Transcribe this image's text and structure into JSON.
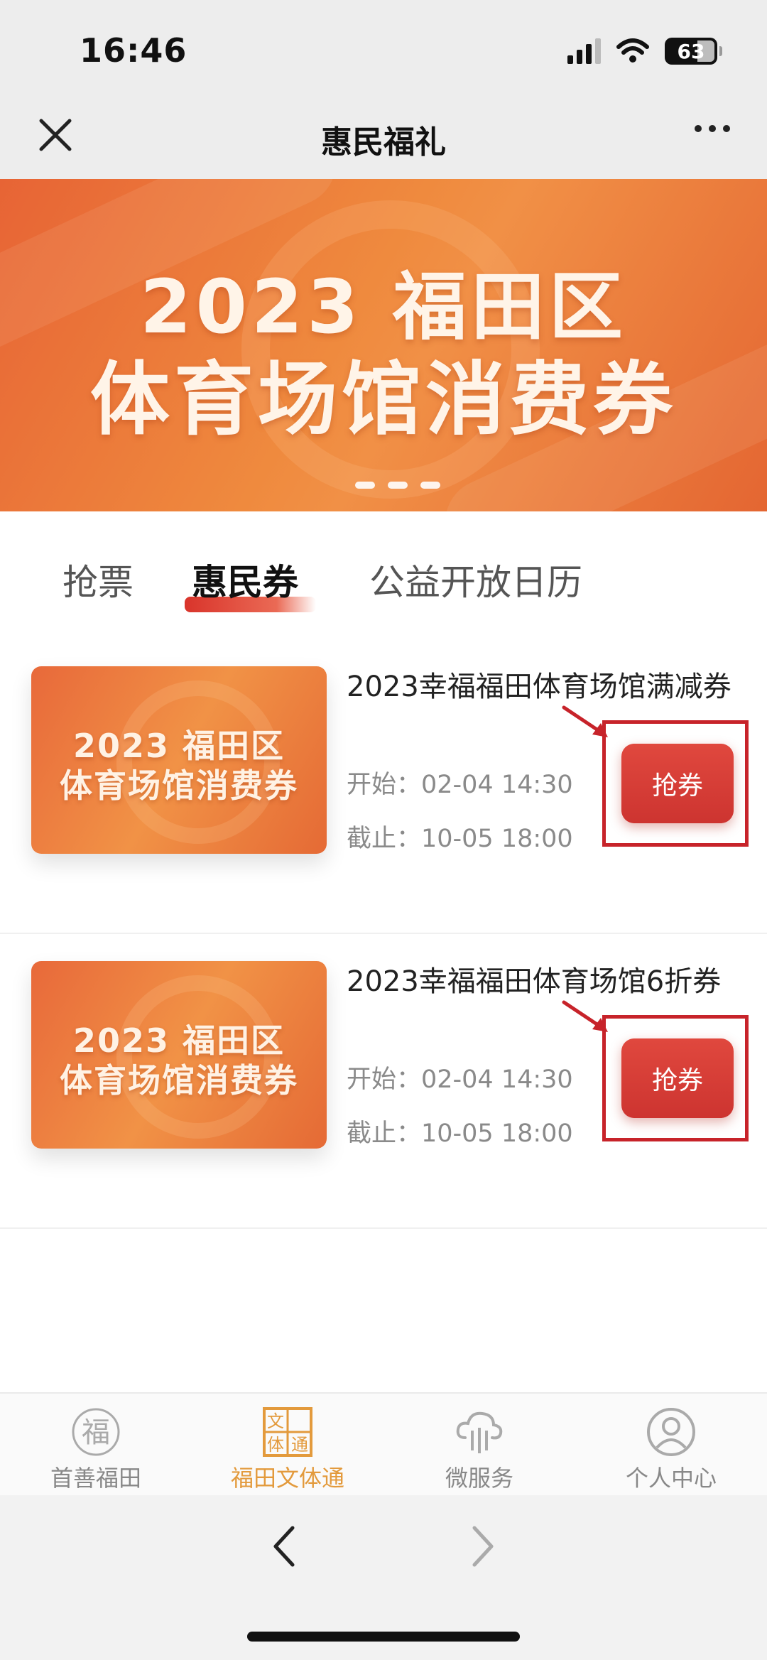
{
  "status": {
    "time": "16:46",
    "battery": "63"
  },
  "nav": {
    "title": "惠民福礼"
  },
  "banner": {
    "line1": "2023 福田区",
    "line2": "体育场馆消费券",
    "slide_count": 3
  },
  "tabs": [
    {
      "label": "抢票",
      "active": false
    },
    {
      "label": "惠民券",
      "active": true
    },
    {
      "label": "公益开放日历",
      "active": false
    }
  ],
  "coupons": [
    {
      "title": "2023幸福福田体育场馆满减券",
      "thumb_line1": "2023 福田区",
      "thumb_line2": "体育场馆消费券",
      "start": "开始：02-04 14:30",
      "end": "截止：10-05 18:00",
      "button": "抢券"
    },
    {
      "title": "2023幸福福田体育场馆6折券",
      "thumb_line1": "2023 福田区",
      "thumb_line2": "体育场馆消费券",
      "start": "开始：02-04 14:30",
      "end": "截止：10-05 18:00",
      "button": "抢券"
    }
  ],
  "bottom_nav": [
    {
      "label": "首善福田",
      "icon": "fu-icon",
      "active": false
    },
    {
      "label": "福田文体通",
      "icon": "wenti-icon",
      "active": true
    },
    {
      "label": "微服务",
      "icon": "cloud-service-icon",
      "active": false
    },
    {
      "label": "个人中心",
      "icon": "user-icon",
      "active": false
    }
  ],
  "colors": {
    "accent": "#e39a3c",
    "button": "#d63b34",
    "banner": "#ef8a3e"
  }
}
